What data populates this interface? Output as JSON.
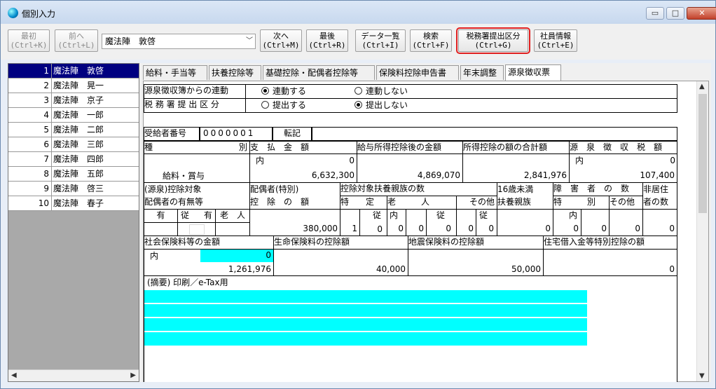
{
  "window": {
    "title": "個別入力",
    "min": "▭",
    "max": "□",
    "close": "✕"
  },
  "toolbar": {
    "first": "最初\n(Ctrl+K)",
    "prev": "前へ\n(Ctrl+L)",
    "employee_select": "魔法陣　敦啓",
    "next": "次へ\n(Ctrl+M)",
    "last": "最後\n(Ctrl+R)",
    "data_list": "データ一覧\n(Ctrl+I)",
    "search": "検索\n(Ctrl+F)",
    "tax_office": "税務署提出区分\n(Ctrl+G)",
    "employee_info": "社員情報\n(Ctrl+E)"
  },
  "employees": [
    {
      "num": "1",
      "name": "魔法陣　敦啓"
    },
    {
      "num": "2",
      "name": "魔法陣　晃一"
    },
    {
      "num": "3",
      "name": "魔法陣　京子"
    },
    {
      "num": "4",
      "name": "魔法陣　一郎"
    },
    {
      "num": "5",
      "name": "魔法陣　二郎"
    },
    {
      "num": "6",
      "name": "魔法陣　三郎"
    },
    {
      "num": "7",
      "name": "魔法陣　四郎"
    },
    {
      "num": "8",
      "name": "魔法陣　五郎"
    },
    {
      "num": "9",
      "name": "魔法陣　啓三"
    },
    {
      "num": "10",
      "name": "魔法陣　春子"
    }
  ],
  "tabs": [
    "給料・手当等",
    "扶養控除等",
    "基礎控除・配偶者控除等",
    "保険料控除申告書",
    "年末調整",
    "源泉徴収票"
  ],
  "form": {
    "link_label": "源泉徴収簿からの連動",
    "link_on": "連動する",
    "link_off": "連動しない",
    "office_label": "税 務 署 提 出 区 分",
    "office_on": "提出する",
    "office_off": "提出しない",
    "recipient_label": "受給者番号",
    "recipient_no": "0000001",
    "transfer": "転記",
    "h_kind": "種",
    "h_kind2": "別",
    "h_pay": "支　払　金　額",
    "h_after": "給与所得控除後の金額",
    "h_total": "所得控除の額の合計額",
    "h_tax": "源　泉　徴　収　税　額",
    "inner": "内",
    "pay_inner": "0",
    "kind_val": "給料・賞与",
    "pay": "6,632,300",
    "after": "4,869,070",
    "total": "2,841,976",
    "tax_inner": "0",
    "tax": "107,400",
    "h_spouse1": "(源泉)控除対象",
    "h_spouse2": "配偶者の有無等",
    "h_sp_ded1": "配偶者(特別)",
    "h_sp_ded2": "控　除　の　額",
    "h_dep": "控除対象扶養親族の数",
    "h_u16": "16歳未満",
    "h_u16b": "扶養親族",
    "h_dis": "障　害　者　の　数",
    "h_nonres": "非居住",
    "h_nonres2": "者の数",
    "h_tokutei": "特　　定",
    "h_rojin": "老　　　人",
    "h_sonota": "その他",
    "h_toku2": "特　　　別",
    "h_sonota2": "その他",
    "h_ari": "有",
    "h_ju": "従",
    "h_ari2": "有",
    "h_rojin2": "老　人",
    "h_ju2": "従",
    "h_uchi": "内",
    "h_ju3": "従",
    "h_ju4": "従",
    "h_uchi2": "内",
    "sp_ded": "380,000",
    "tokutei": "1",
    "tokutei_ju": "0",
    "rojin_uchi": "0",
    "rojin": "0",
    "rojin_ju": "0",
    "sonota": "0",
    "sonota_ju": "0",
    "u16": "0",
    "dis_uchi": "0",
    "dis_toku": "0",
    "dis_sonota": "0",
    "nonres": "0",
    "h_social": "社会保険料等の金額",
    "h_life": "生命保険料の控除額",
    "h_quake": "地震保険料の控除額",
    "h_house": "住宅借入金等特別控除の額",
    "social_inner": "0",
    "social": "1,261,976",
    "life": "40,000",
    "quake": "50,000",
    "house": "0",
    "remarks": "(摘要) 印刷／e-Tax用"
  }
}
